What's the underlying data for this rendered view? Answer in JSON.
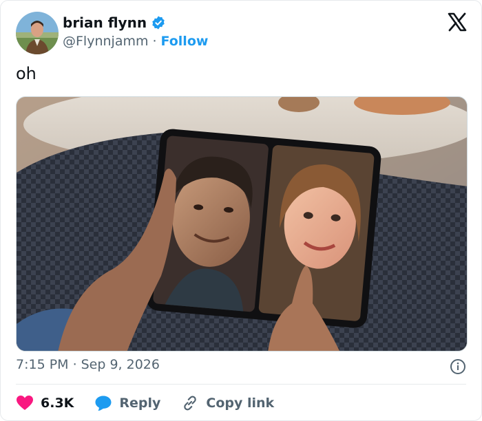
{
  "author": {
    "display_name": "brian flynn",
    "handle": "@Flynnjamm",
    "separator": "·",
    "follow_label": "Follow"
  },
  "tweet": {
    "text": "oh",
    "time": "7:15 PM",
    "separator": "·",
    "date": "Sep 9, 2026"
  },
  "actions": {
    "likes": "6.3K",
    "reply_label": "Reply",
    "copy_link_label": "Copy link"
  },
  "colors": {
    "accent": "#1d9bf0",
    "like": "#f91880",
    "text_secondary": "#536471"
  },
  "icons": [
    "verified-badge-icon",
    "x-logo-icon",
    "info-icon",
    "heart-icon",
    "reply-bubble-icon",
    "link-icon"
  ]
}
